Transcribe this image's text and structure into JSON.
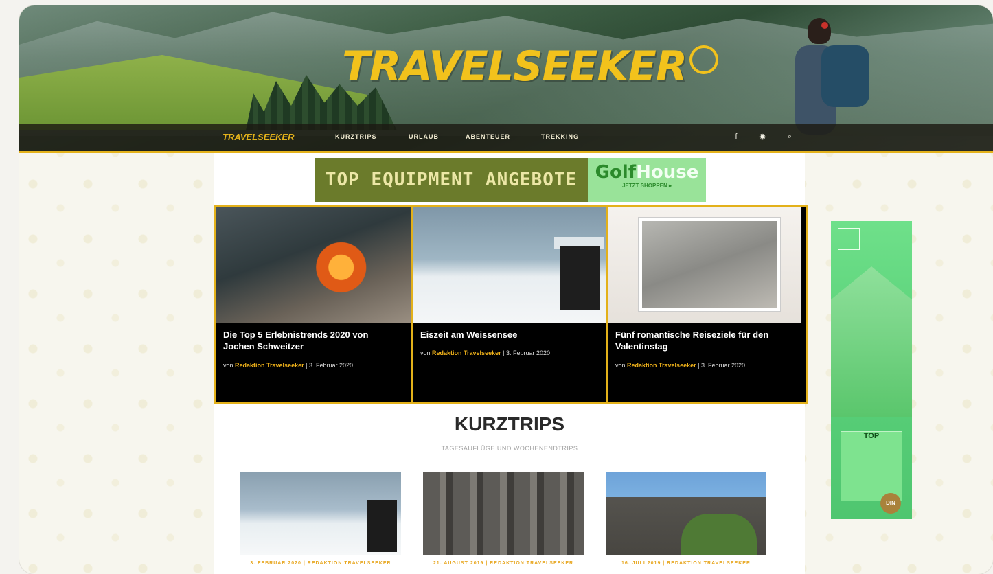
{
  "site": {
    "logo_text": "TRAVELSEEKER",
    "nav_logo_text": "TRAVELSEEKER"
  },
  "nav": {
    "items": [
      {
        "label": "KURZTRIPS"
      },
      {
        "label": "URLAUB"
      },
      {
        "label": "ABENTEUER"
      },
      {
        "label": "TREKKING"
      }
    ],
    "icons": [
      "facebook-icon",
      "rss-icon",
      "search-icon"
    ]
  },
  "ad_banner": {
    "text": "TOP EQUIPMENT ANGEBOTE",
    "brand_part1": "Golf",
    "brand_part2": "House",
    "cta": "JETZT SHOPPEN ▸"
  },
  "featured": [
    {
      "title": "Die Top 5 Erlebnistrends 2020 von Jochen Schweitzer",
      "by": "von",
      "author": "Redaktion Travelseeker",
      "date": "| 3. Februar 2020"
    },
    {
      "title": "Eiszeit am Weissensee",
      "by": "von",
      "author": "Redaktion Travelseeker",
      "date": "| 3. Februar 2020"
    },
    {
      "title": "Fünf romantische Reiseziele für den Valentinstag",
      "by": "von",
      "author": "Redaktion Travelseeker",
      "date": "| 3. Februar 2020"
    }
  ],
  "section": {
    "title": "KURZTRIPS",
    "subtitle": "TAGESAUFLÜGE UND WOCHENENDTRIPS"
  },
  "trips": [
    {
      "caption": "3. FEBRUAR 2020 | REDAKTION TRAVELSEEKER"
    },
    {
      "caption": "21. AUGUST 2019 | REDAKTION TRAVELSEEKER"
    },
    {
      "caption": "16. JULI 2019 | REDAKTION TRAVELSEEKER"
    }
  ],
  "side_ad": {
    "top_label": "TOP",
    "seal": "DIN"
  },
  "colors": {
    "accent": "#e3b11a",
    "nav_bg": "#1c1a12",
    "ad_green": "#6b7b2b",
    "golf_green": "#99e399"
  }
}
